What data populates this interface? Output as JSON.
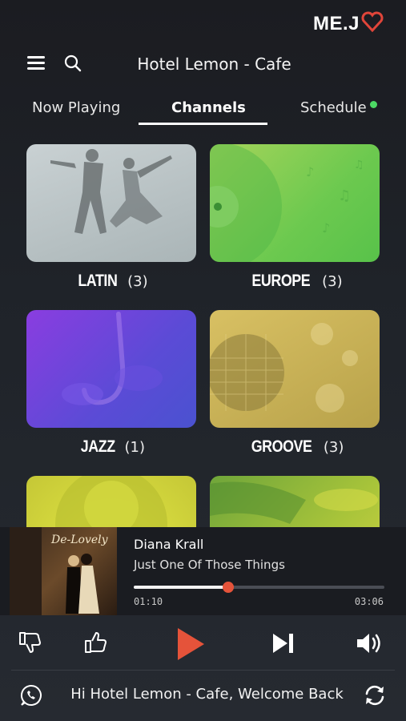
{
  "brand": {
    "logo_text": "ME.J"
  },
  "header": {
    "title": "Hotel Lemon - Cafe"
  },
  "tabs": [
    {
      "label": "Now Playing"
    },
    {
      "label": "Channels"
    },
    {
      "label": "Schedule"
    }
  ],
  "channels": [
    {
      "name": "LATIN",
      "count": "(3)"
    },
    {
      "name": "EUROPE",
      "count": "(3)"
    },
    {
      "name": "JAZZ",
      "count": "(1)"
    },
    {
      "name": "GROOVE",
      "count": "(3)"
    }
  ],
  "player": {
    "album_title": "De-Lovely",
    "artist": "Diana Krall",
    "track": "Just One Of Those Things",
    "current_time": "01:10",
    "total_time": "03:06",
    "progress_fraction": 0.376
  },
  "footer": {
    "welcome": "Hi Hotel Lemon - Cafe, Welcome Back"
  },
  "colors": {
    "accent": "#e5533a",
    "online_dot": "#4cd964"
  }
}
